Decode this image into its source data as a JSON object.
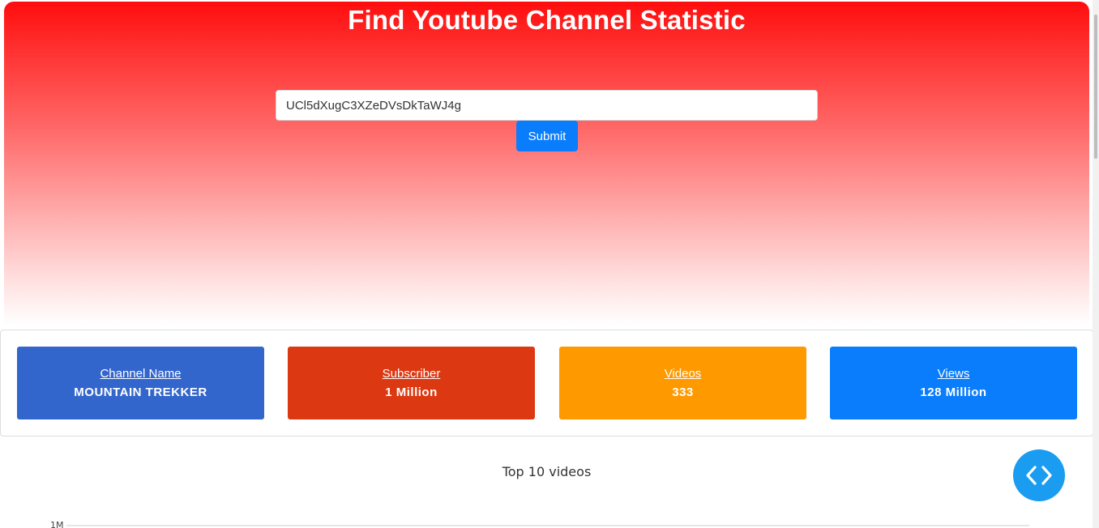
{
  "header": {
    "title": "Find Youtube Channel Statistic"
  },
  "search": {
    "channel_id_value": "UCl5dXugC3XZeDVsDkTaWJ4g",
    "submit_label": "Submit"
  },
  "stats": [
    {
      "label": "Channel Name",
      "value": "MOUNTAIN TREKKER",
      "color": "#3366cc"
    },
    {
      "label": "Subscriber",
      "value": "1 Million",
      "color": "#dc3912"
    },
    {
      "label": "Videos",
      "value": "333",
      "color": "#ff9900"
    },
    {
      "label": "Views",
      "value": "128 Million",
      "color": "#0a7dfc"
    }
  ],
  "chart": {
    "title": "Top 10 videos",
    "y_tick_top": "1M"
  },
  "fab": {
    "icon": "code-icon",
    "color": "#1a9cf0"
  }
}
